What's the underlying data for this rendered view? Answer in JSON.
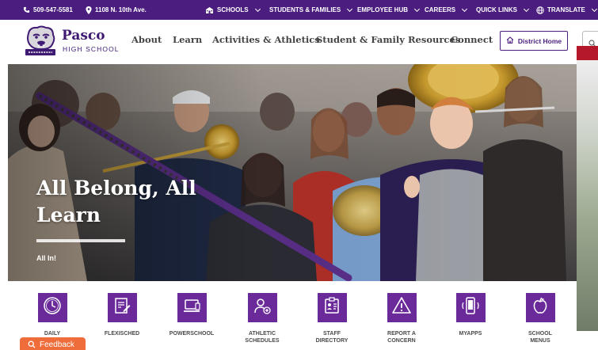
{
  "colors": {
    "brand_purple": "#4b1d7f",
    "tile_purple": "#6b2a9a",
    "feedback_orange": "#ee6d3a"
  },
  "utility_bar": {
    "phone": "509-547-5581",
    "address": "1108 N. 10th Ave.",
    "menus": [
      "SCHOOLS",
      "STUDENTS & FAMILIES",
      "EMPLOYEE HUB",
      "CAREERS",
      "QUICK LINKS",
      "TRANSLATE"
    ]
  },
  "header": {
    "school_name": "Pasco",
    "school_subtitle": "HIGH SCHOOL",
    "nav": [
      "About",
      "Learn",
      "Activities & Athletics",
      "Student & Family Resources",
      "Connect"
    ],
    "district_button": "District Home"
  },
  "hero": {
    "title": "All Belong, All Learn",
    "subtitle": "All In!"
  },
  "quick_links": [
    {
      "label": "DAILY",
      "icon": "clock-icon"
    },
    {
      "label": "FLEXISCHED",
      "icon": "schedule-icon"
    },
    {
      "label": "POWERSCHOOL",
      "icon": "laptop-icon"
    },
    {
      "label": "ATHLETIC\nSCHEDULES",
      "icon": "person-add-icon"
    },
    {
      "label": "STAFF\nDIRECTORY",
      "icon": "id-card-icon"
    },
    {
      "label": "REPORT A\nCONCERN",
      "icon": "warning-icon"
    },
    {
      "label": "MYAPPS",
      "icon": "phone-icon"
    },
    {
      "label": "SCHOOL\nMENUS",
      "icon": "apple-icon"
    }
  ],
  "feedback": {
    "label": "Feedback"
  }
}
